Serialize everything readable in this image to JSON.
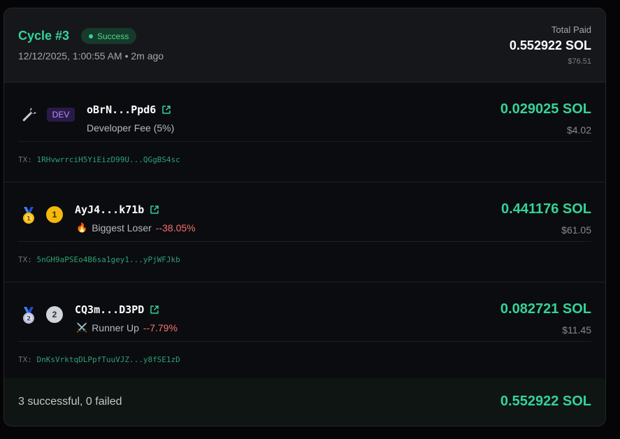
{
  "header": {
    "cycle_title": "Cycle #3",
    "status_badge": "Success",
    "timestamp": "12/12/2025, 1:00:55 AM",
    "separator": "•",
    "relative_time": "2m ago",
    "total_label": "Total Paid",
    "total_value": "0.552922 SOL",
    "total_usd": "$76.51"
  },
  "rows": [
    {
      "badge": "DEV",
      "icon": "wrench-icon",
      "address": "oBrN...Ppd6",
      "label": "Developer Fee (5%)",
      "amount": "0.029025 SOL",
      "usd": "$4.02",
      "tx_prefix": "TX:",
      "tx_hash": "1RHvwrrciH5YiEizD99U...QGgBS4sc"
    },
    {
      "rank": "1",
      "icon": "gold-medal-icon",
      "address": "AyJ4...k71b",
      "label_emoji": "🔥",
      "label": "Biggest Loser",
      "change": "--38.05%",
      "amount": "0.441176 SOL",
      "usd": "$61.05",
      "tx_prefix": "TX:",
      "tx_hash": "5nGH9aPSEo4B6sa1gey1...yPjWFJkb"
    },
    {
      "rank": "2",
      "icon": "silver-medal-icon",
      "address": "CQ3m...D3PD",
      "label_emoji": "⚔️",
      "label": "Runner Up",
      "change": "--7.79%",
      "amount": "0.082721 SOL",
      "usd": "$11.45",
      "tx_prefix": "TX:",
      "tx_hash": "DnKsVrktqDLPpfTuuVJZ...y8fSE1zD"
    }
  ],
  "footer": {
    "summary": "3 successful, 0 failed",
    "total": "0.552922 SOL"
  },
  "colors": {
    "accent": "#34d399",
    "negative": "#f87171",
    "dev": "#b794f6",
    "gold": "#f5b80b",
    "silver": "#d1d5db"
  }
}
